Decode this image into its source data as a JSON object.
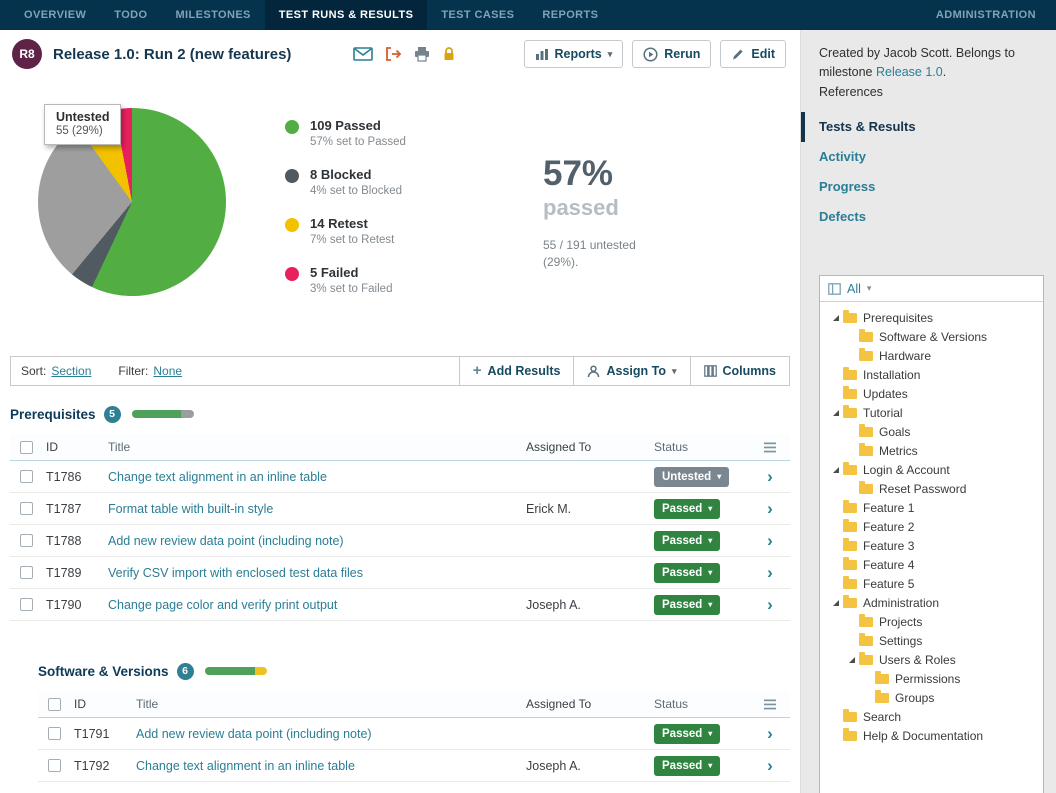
{
  "nav": {
    "items": [
      {
        "label": "OVERVIEW",
        "active": false
      },
      {
        "label": "TODO",
        "active": false
      },
      {
        "label": "MILESTONES",
        "active": false
      },
      {
        "label": "TEST RUNS & RESULTS",
        "active": true
      },
      {
        "label": "TEST CASES",
        "active": false
      },
      {
        "label": "REPORTS",
        "active": false
      }
    ],
    "right": "ADMINISTRATION"
  },
  "header": {
    "badge": "R8",
    "title": "Release 1.0: Run 2 (new features)",
    "reports_button": "Reports",
    "rerun_button": "Rerun",
    "edit_button": "Edit"
  },
  "summary": {
    "tooltip": {
      "label": "Untested",
      "value": "55 (29%)"
    },
    "legend": [
      {
        "label": "109 Passed",
        "sub": "57% set to Passed",
        "color": "#52AE43"
      },
      {
        "label": "8 Blocked",
        "sub": "4% set to Blocked",
        "color": "#515A60"
      },
      {
        "label": "14 Retest",
        "sub": "7% set to Retest",
        "color": "#F2C100"
      },
      {
        "label": "5 Failed",
        "sub": "3% set to Failed",
        "color": "#E8205D"
      }
    ],
    "big_percent": "57%",
    "big_label": "passed",
    "untested_note": "55 / 191 untested (29%)."
  },
  "chart_data": {
    "type": "pie",
    "title": "",
    "total_tests": 191,
    "legend_position": "right",
    "slices": [
      {
        "label": "Passed",
        "count": 109,
        "pct": 57,
        "color": "#52AE43"
      },
      {
        "label": "Blocked",
        "count": 8,
        "pct": 4,
        "color": "#515A60"
      },
      {
        "label": "Untested",
        "count": 55,
        "pct": 29,
        "color": "#9E9E9E"
      },
      {
        "label": "Retest",
        "count": 14,
        "pct": 7,
        "color": "#F2C100"
      },
      {
        "label": "Failed",
        "count": 5,
        "pct": 3,
        "color": "#E8205D"
      }
    ]
  },
  "toolbar": {
    "sort_label": "Sort:",
    "sort_value": "Section",
    "filter_label": "Filter:",
    "filter_value": "None",
    "add_results": "Add Results",
    "assign_to": "Assign To",
    "columns": "Columns"
  },
  "sections": [
    {
      "title": "Prerequisites",
      "count": "5",
      "indent": false,
      "progress": [
        {
          "color": "#4FA058",
          "pct": 80
        },
        {
          "color": "#9B9DA1",
          "pct": 20
        }
      ],
      "columns": [
        "ID",
        "Title",
        "Assigned To",
        "Status"
      ],
      "rows": [
        {
          "id": "T1786",
          "title": "Change text alignment in an inline table",
          "assigned": "",
          "status": "Untested"
        },
        {
          "id": "T1787",
          "title": "Format table with built-in style",
          "assigned": "Erick M.",
          "status": "Passed"
        },
        {
          "id": "T1788",
          "title": "Add new review data point (including note)",
          "assigned": "",
          "status": "Passed"
        },
        {
          "id": "T1789",
          "title": "Verify CSV import with enclosed test data files",
          "assigned": "",
          "status": "Passed"
        },
        {
          "id": "T1790",
          "title": "Change page color and verify print output",
          "assigned": "Joseph A.",
          "status": "Passed"
        }
      ]
    },
    {
      "title": "Software & Versions",
      "count": "6",
      "indent": true,
      "progress": [
        {
          "color": "#4FA058",
          "pct": 82
        },
        {
          "color": "#EFC224",
          "pct": 18
        }
      ],
      "columns": [
        "ID",
        "Title",
        "Assigned To",
        "Status"
      ],
      "rows": [
        {
          "id": "T1791",
          "title": "Add new review data point (including note)",
          "assigned": "",
          "status": "Passed"
        },
        {
          "id": "T1792",
          "title": "Change text alignment in an inline table",
          "assigned": "Joseph A.",
          "status": "Passed"
        }
      ]
    }
  ],
  "colors": {
    "status": {
      "Passed": "#2F8540",
      "Untested": "#7B8790"
    },
    "accent": "#2A7E95",
    "nav_bg": "#05334D",
    "run_badge_bg": "#5F2347",
    "section_badge_bg": "#2F7F95"
  },
  "icons": {
    "caret_down": "▾",
    "row_chevron": "›",
    "add_plus": "+"
  },
  "sidebar": {
    "meta": {
      "text1": "Created by Jacob Scott. Belongs to milestone ",
      "link": "Release 1.0",
      "text2": ".",
      "references": "References"
    },
    "links": [
      {
        "label": "Tests & Results",
        "active": true
      },
      {
        "label": "Activity",
        "active": false
      },
      {
        "label": "Progress",
        "active": false
      },
      {
        "label": "Defects",
        "active": false
      }
    ],
    "tree_header": "All",
    "tree": [
      {
        "label": "Prerequisites",
        "depth": 0,
        "expanded": true
      },
      {
        "label": "Software & Versions",
        "depth": 1,
        "expanded": false
      },
      {
        "label": "Hardware",
        "depth": 1,
        "expanded": false
      },
      {
        "label": "Installation",
        "depth": 0,
        "expanded": false
      },
      {
        "label": "Updates",
        "depth": 0,
        "expanded": false
      },
      {
        "label": "Tutorial",
        "depth": 0,
        "expanded": true
      },
      {
        "label": "Goals",
        "depth": 1,
        "expanded": false
      },
      {
        "label": "Metrics",
        "depth": 1,
        "expanded": false
      },
      {
        "label": "Login & Account",
        "depth": 0,
        "expanded": true
      },
      {
        "label": "Reset Password",
        "depth": 1,
        "expanded": false
      },
      {
        "label": "Feature 1",
        "depth": 0,
        "expanded": false
      },
      {
        "label": "Feature 2",
        "depth": 0,
        "expanded": false
      },
      {
        "label": "Feature 3",
        "depth": 0,
        "expanded": false
      },
      {
        "label": "Feature 4",
        "depth": 0,
        "expanded": false
      },
      {
        "label": "Feature 5",
        "depth": 0,
        "expanded": false
      },
      {
        "label": "Administration",
        "depth": 0,
        "expanded": true
      },
      {
        "label": "Projects",
        "depth": 1,
        "expanded": false
      },
      {
        "label": "Settings",
        "depth": 1,
        "expanded": false
      },
      {
        "label": "Users & Roles",
        "depth": 1,
        "expanded": true
      },
      {
        "label": "Permissions",
        "depth": 2,
        "expanded": false
      },
      {
        "label": "Groups",
        "depth": 2,
        "expanded": false
      },
      {
        "label": "Search",
        "depth": 0,
        "expanded": false
      },
      {
        "label": "Help & Documentation",
        "depth": 0,
        "expanded": false
      }
    ]
  }
}
